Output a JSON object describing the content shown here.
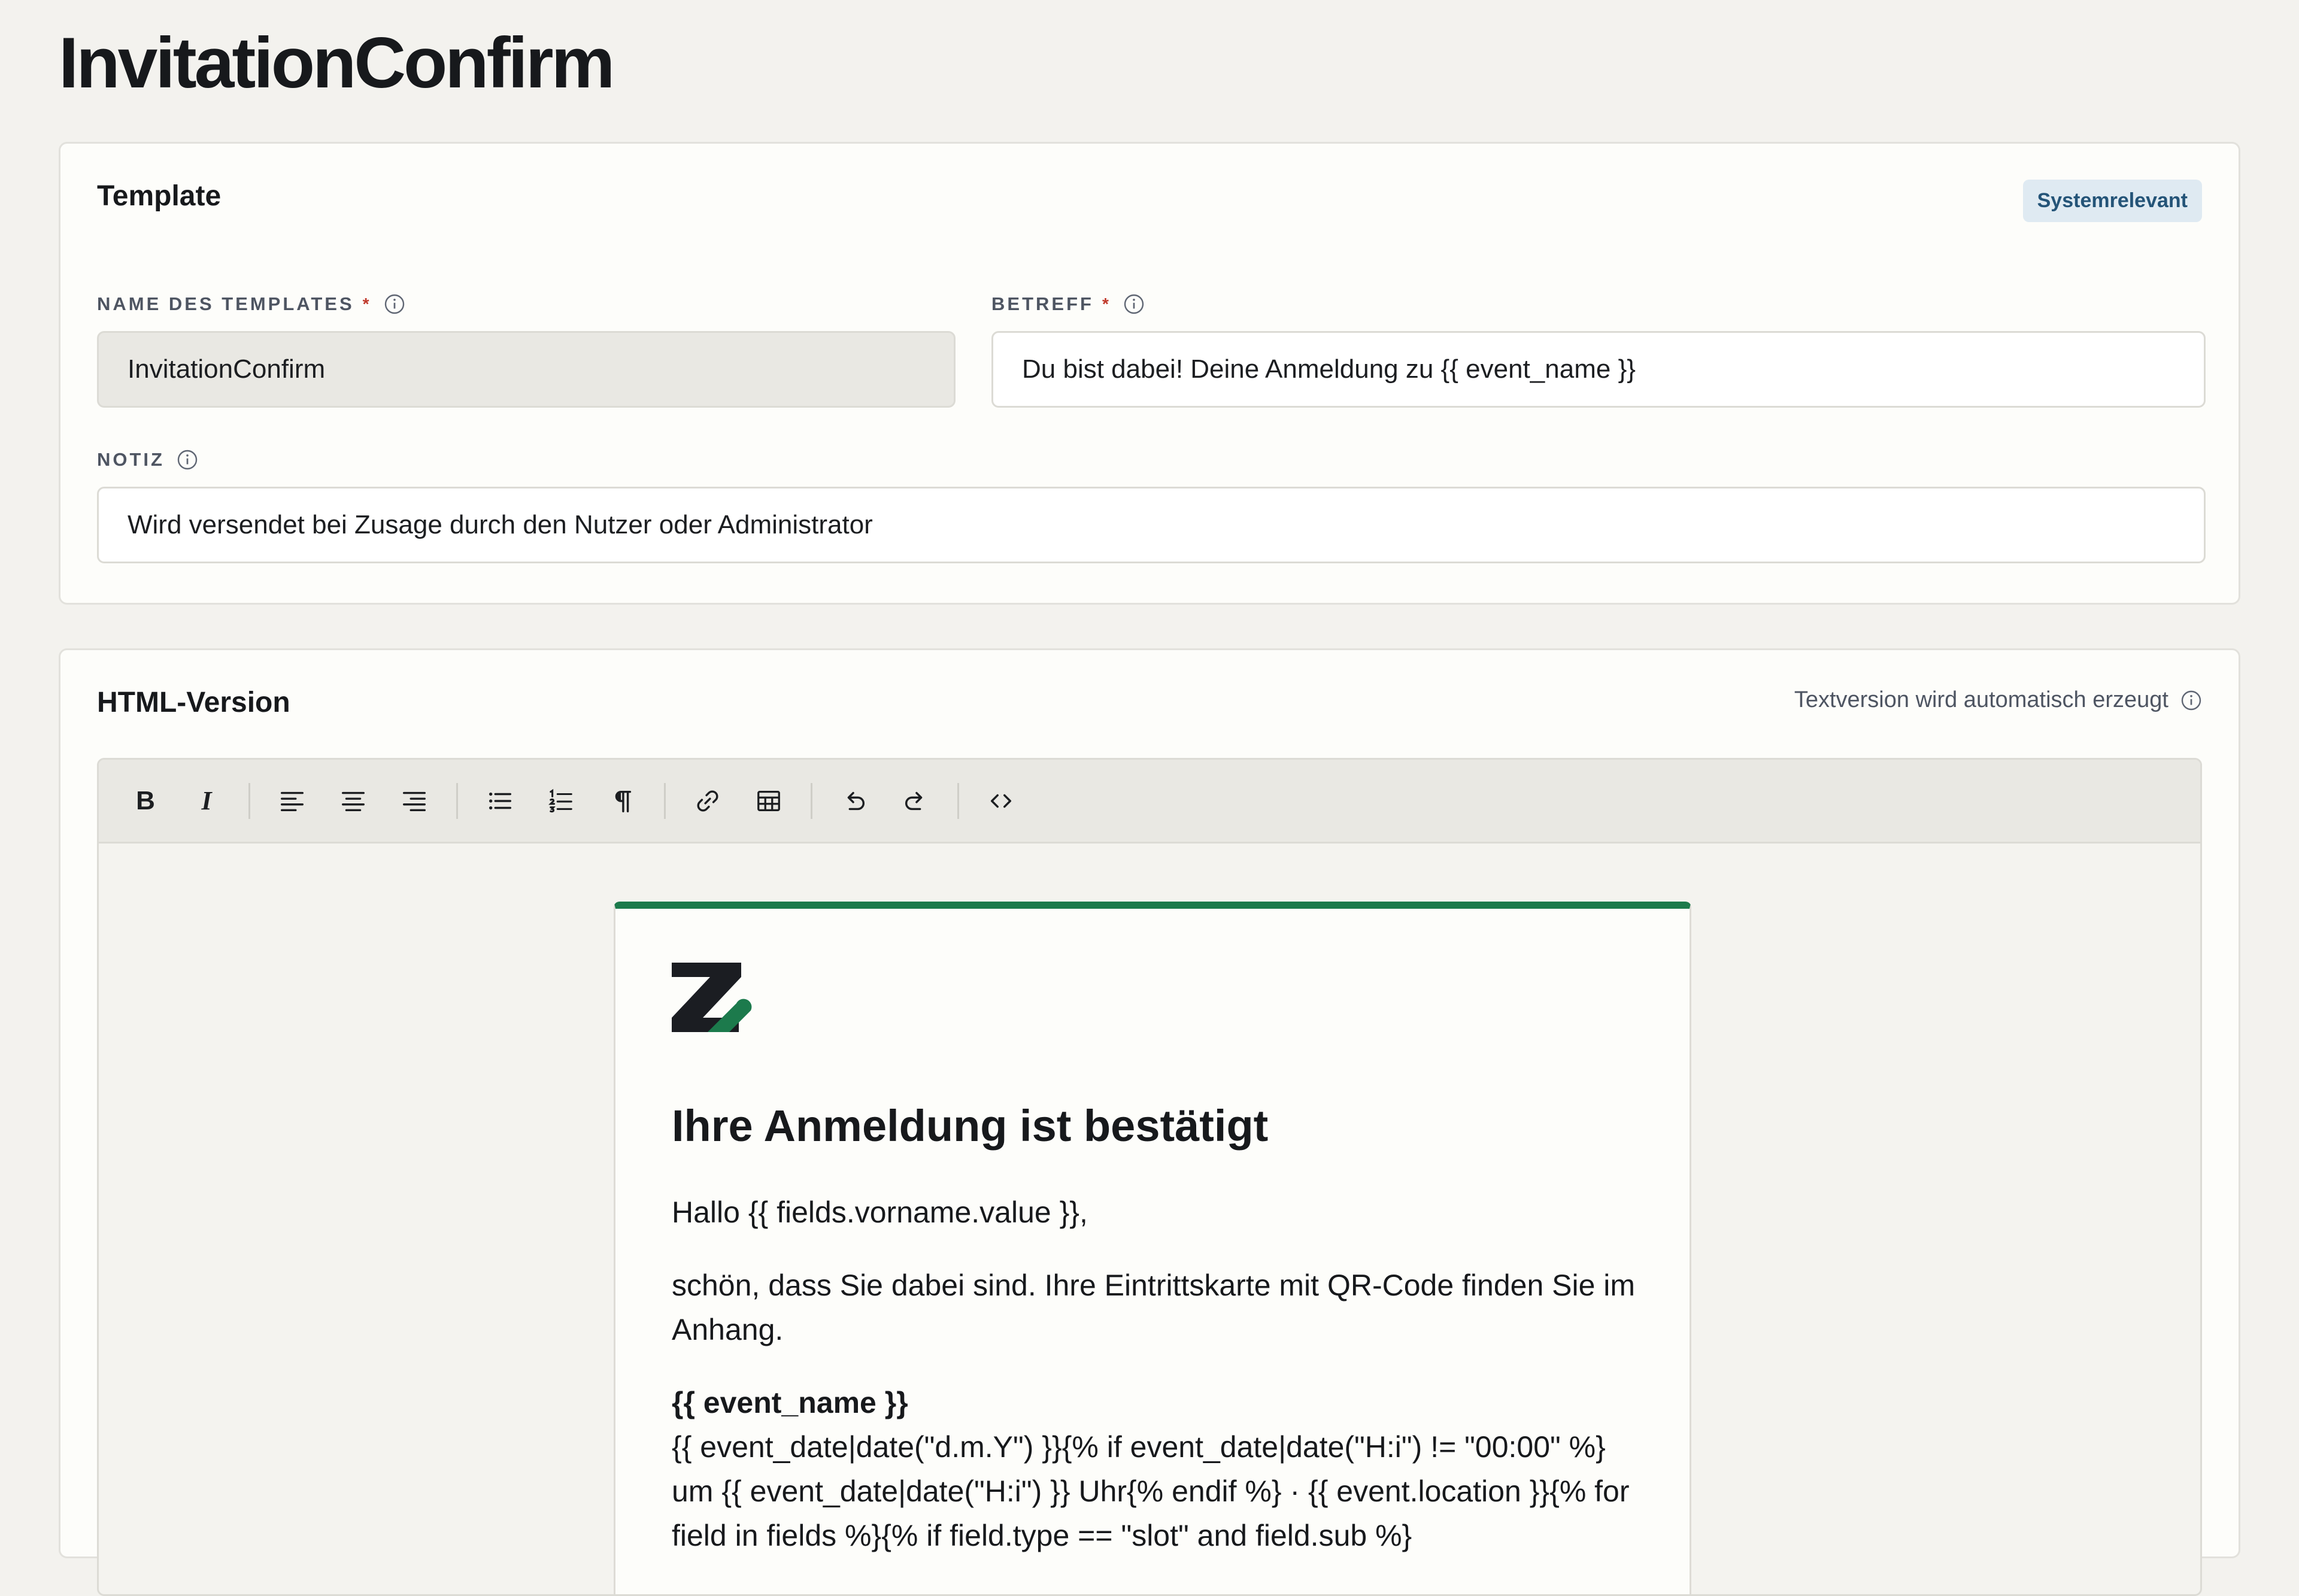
{
  "page": {
    "title": "InvitationConfirm"
  },
  "template_card": {
    "title": "Template",
    "badge": "Systemrelevant",
    "name_field": {
      "label": "NAME DES TEMPLATES",
      "required_mark": "*",
      "value": "InvitationConfirm"
    },
    "subject_field": {
      "label": "BETREFF",
      "required_mark": "*",
      "value": "Du bist dabei! Deine Anmeldung zu {{ event_name }}"
    },
    "note_field": {
      "label": "NOTIZ",
      "value": "Wird versendet bei Zusage durch den Nutzer oder Administrator"
    }
  },
  "html_card": {
    "title": "HTML-Version",
    "hint": "Textversion wird automatisch erzeugt",
    "toolbar": {
      "bold": "B",
      "italic": "I"
    },
    "email": {
      "accent_color": "#1c7a4c",
      "heading": "Ihre Anmeldung ist bestätigt",
      "greeting": "Hallo {{ fields.vorname.value }},",
      "intro": "schön, dass Sie dabei sind. Ihre Eintrittskarte mit QR-Code finden Sie im Anhang.",
      "event_name": "{{ event_name }}",
      "event_details": "{{ event_date|date(\"d.m.Y\") }}{% if event_date|date(\"H:i\") != \"00:00\" %} um {{ event_date|date(\"H:i\") }} Uhr{% endif %} · {{ event.location }}{% for field in fields %}{% if field.type == \"slot\" and field.sub %}"
    }
  }
}
